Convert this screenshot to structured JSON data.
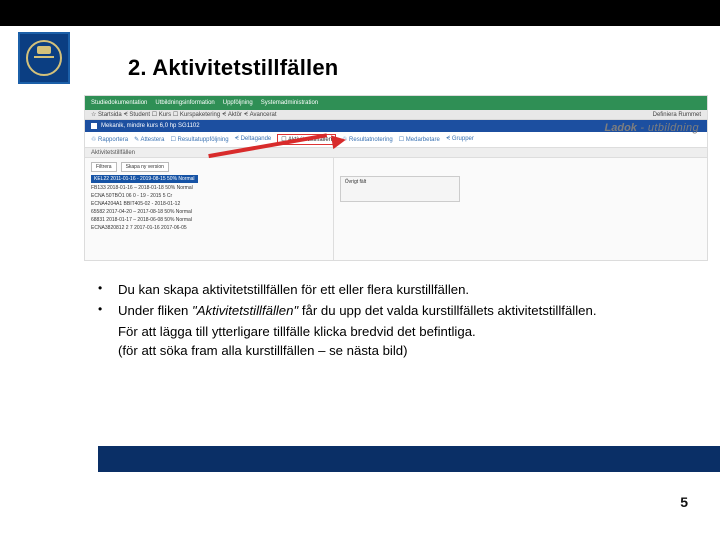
{
  "header": {
    "title": "2. Aktivitetstillfällen"
  },
  "screenshot": {
    "greenbar": {
      "i1": "Studiedokumentation",
      "i2": "Utbildningsinformation",
      "i3": "Uppföljning",
      "i4": "Systemadministration"
    },
    "greyLeft": "☆ Startsida   ᗕ Student   ☐ Kurs   ☐ Kurspaketering   ᗕ Aktör   ᗕ Avancerat",
    "greyRight": "Definiera  Rummet",
    "bluehdr_icon": "📄",
    "bluehdr": "Mekanik, mindre kurs 6,0 hp SG1102",
    "tabs": {
      "t1": "♲ Rapportera",
      "t2": "✎ Attestera",
      "t3": "☐ Resultatuppföljning",
      "t4": "ᗕ Deltagande",
      "active": "☐ Aktivitetstillfällen",
      "t5": "♲ Resultatnotering",
      "t6": "☐ Medarbetare",
      "t7": "ᗕ Grupper"
    },
    "sub": "Aktivitetstillfällen",
    "btn1": "Filtrera",
    "btn2": "Skapa ny version",
    "sel": "KEL22 2011-01-16 - 2019-08-15  50% Normal",
    "l1": "FB133  2018-01-16 – 2018-01-18  50% Normal",
    "l2": "ECNA 50TBÖ1 06 0 - 19 - 2015 5 Cr",
    "l3": "ECNA4204A1 BBIT405-02 - 2018-01-12",
    "l4": "65582  2017-04-20 – 2017-08-18  50% Normal",
    "l5": "68831  2018-01-17 – 2018-06-08  50% Normal",
    "l6": "ECNA3820812 2 7 2017-01-16  2017-06-05",
    "ladok_main": "Ladok",
    "ladok_sub": " - utbildning",
    "boxh": "Övrigt fält"
  },
  "bullets": {
    "b1": "Du kan skapa aktivitetstillfällen för ett eller flera kurstillfällen.",
    "b2_pre": "Under fliken ",
    "b2_em": "\"Aktivitetstillfällen\"",
    "b2_post": " får du upp det valda kurstillfällets aktivitetstillfällen.",
    "b3": "För att lägga till ytterligare tillfälle klicka bredvid det befintliga.",
    "b4": "(för att söka fram alla kurstillfällen – se nästa bild)"
  },
  "page_number": "5"
}
